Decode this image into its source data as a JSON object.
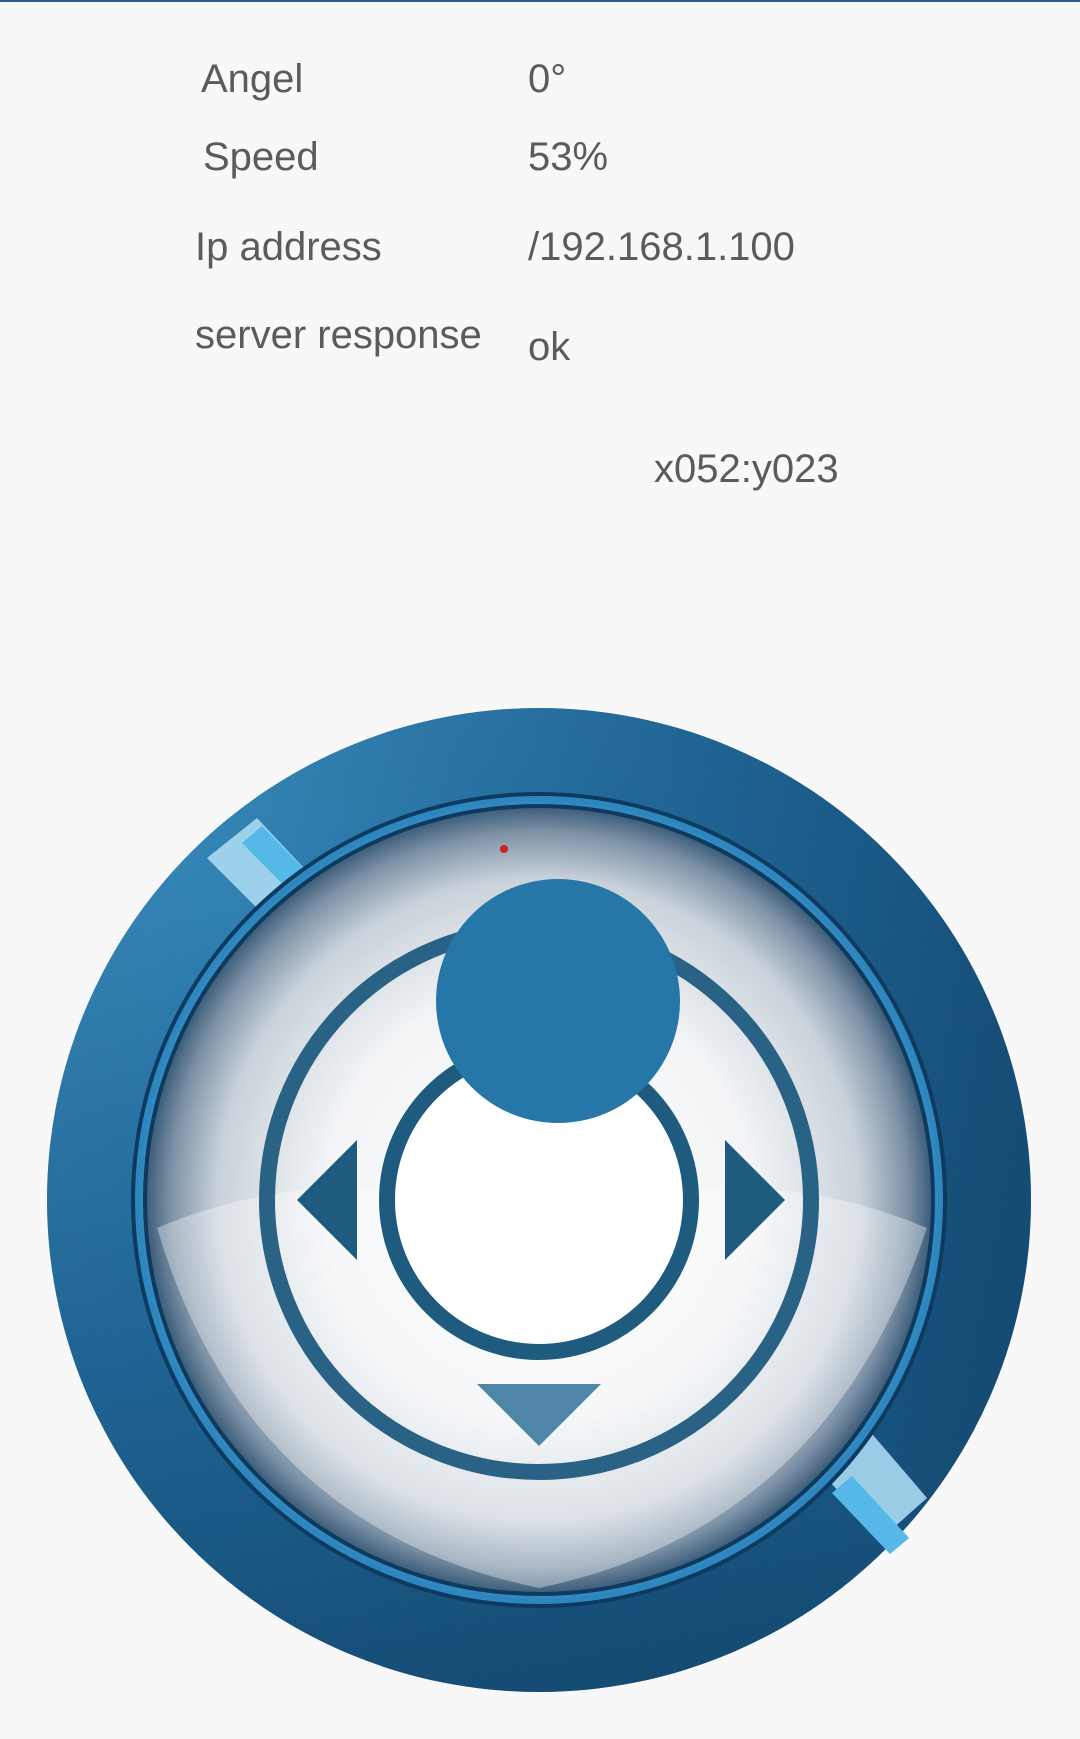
{
  "status": {
    "angle_label": "Angel",
    "angle_value": "0°",
    "speed_label": "Speed",
    "speed_value": "53%",
    "ip_label": "Ip address",
    "ip_value": "/192.168.1.100",
    "response_label": "server response",
    "response_value": "ok"
  },
  "joystick": {
    "coords_text": "x052:y023",
    "knob_color": "#2677a8",
    "ring_dark": "#0c3a5c",
    "ring_light": "#4aa6d8",
    "arrow_color": "#1f5b7e",
    "speed_percent": 53,
    "angle_degrees": 0
  }
}
